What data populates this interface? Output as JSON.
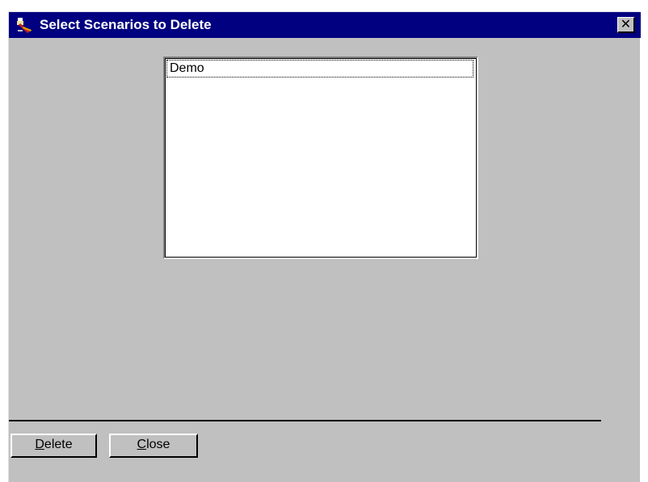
{
  "window": {
    "title": "Select Scenarios to Delete",
    "close_glyph": "✕",
    "icon": "app-icon"
  },
  "list": {
    "items": [
      "Demo"
    ],
    "selected_index": 0
  },
  "buttons": {
    "delete": {
      "mnemonic": "D",
      "rest": "elete"
    },
    "close": {
      "mnemonic": "C",
      "rest": "lose"
    }
  },
  "colors": {
    "titlebar": "#000080",
    "face": "#c0c0c0"
  }
}
